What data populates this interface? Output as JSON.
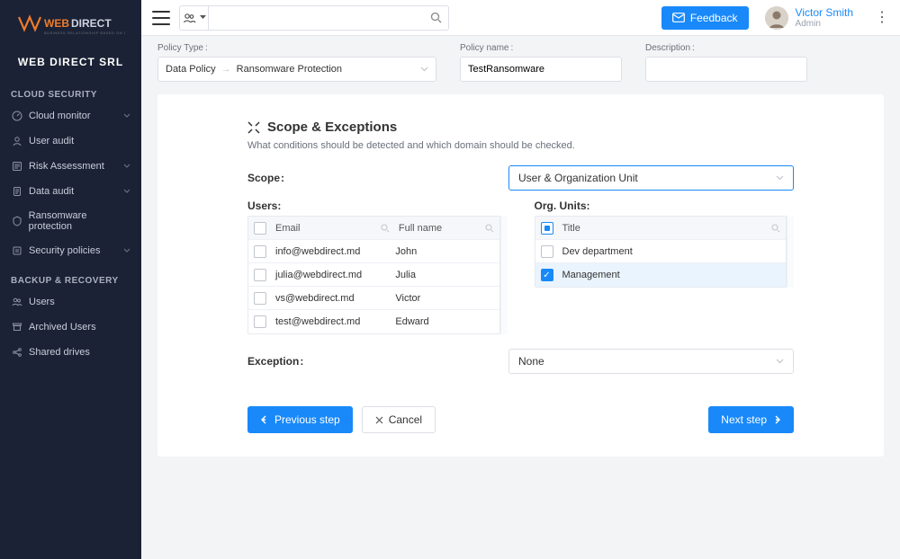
{
  "company": "WEB DIRECT SRL",
  "header": {
    "feedback_label": "Feedback",
    "user_name": "Victor Smith",
    "user_role": "Admin",
    "search_placeholder": ""
  },
  "sidebar": {
    "section1": "CLOUD SECURITY",
    "items1": [
      {
        "label": "Cloud monitor",
        "expandable": true
      },
      {
        "label": "User audit",
        "expandable": false
      },
      {
        "label": "Risk Assessment",
        "expandable": true
      },
      {
        "label": "Data audit",
        "expandable": true
      },
      {
        "label": "Ransomware protection",
        "expandable": false
      },
      {
        "label": "Security policies",
        "expandable": true
      }
    ],
    "section2": "BACKUP & RECOVERY",
    "items2": [
      {
        "label": "Users"
      },
      {
        "label": "Archived Users"
      },
      {
        "label": "Shared drives"
      }
    ]
  },
  "policy": {
    "type_label": "Policy Type",
    "type_root": "Data Policy",
    "type_leaf": "Ransomware Protection",
    "name_label": "Policy name",
    "name_value": "TestRansomware",
    "desc_label": "Description",
    "desc_value": ""
  },
  "panel": {
    "title": "Scope & Exceptions",
    "subtitle": "What conditions should be detected and which domain should be checked.",
    "scope_label": "Scope",
    "scope_value": "User & Organization Unit",
    "users_label": "Users",
    "users_headers": {
      "email": "Email",
      "name": "Full name"
    },
    "users": [
      {
        "email": "info@webdirect.md",
        "name": "John"
      },
      {
        "email": "julia@webdirect.md",
        "name": "Julia"
      },
      {
        "email": "vs@webdirect.md",
        "name": "Victor"
      },
      {
        "email": "test@webdirect.md",
        "name": "Edward"
      }
    ],
    "org_label": "Org. Units",
    "org_header": "Title",
    "org_units": [
      {
        "title": "Dev department",
        "checked": false
      },
      {
        "title": "Management",
        "checked": true
      }
    ],
    "exception_label": "Exception",
    "exception_value": "None",
    "prev_label": "Previous step",
    "cancel_label": "Cancel",
    "next_label": "Next step"
  }
}
